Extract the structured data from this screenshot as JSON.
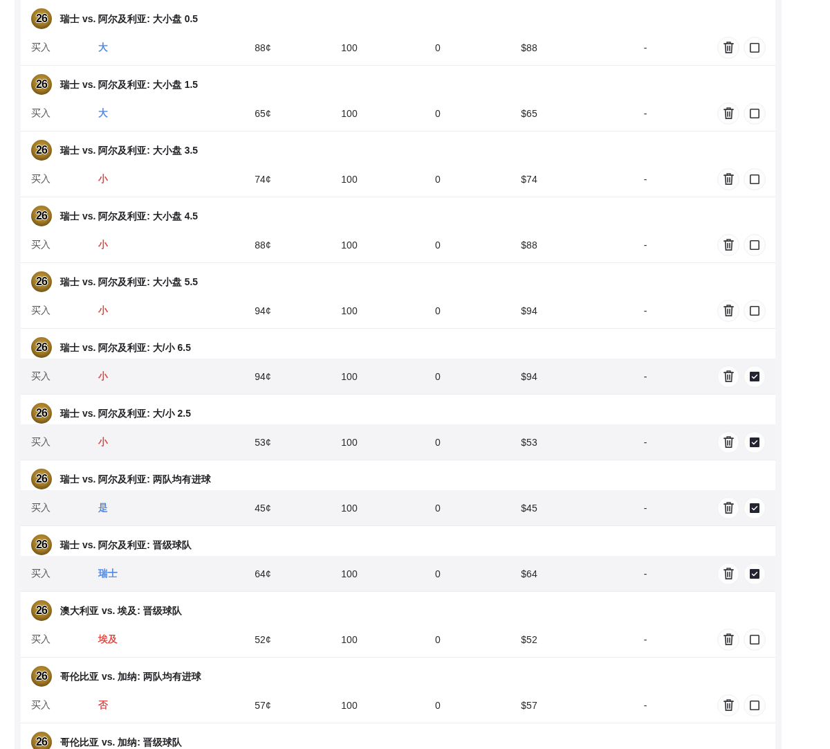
{
  "positions": [
    {
      "badge": "26",
      "title": "瑞士 vs. 阿尔及利亚: 大小盘 0.5",
      "column_1": "买入",
      "column_2": "大",
      "color": "#3f7de0",
      "column_3": "88¢",
      "column_4": "100",
      "column_5": "0",
      "column_6": "$88",
      "column_7": "-",
      "checked": false
    },
    {
      "badge": "26",
      "title": "瑞士 vs. 阿尔及利亚: 大小盘 1.5",
      "column_1": "买入",
      "column_2": "大",
      "color": "#3f7de0",
      "column_3": "65¢",
      "column_4": "100",
      "column_5": "0",
      "column_6": "$65",
      "column_7": "-",
      "checked": false
    },
    {
      "badge": "26",
      "title": "瑞士 vs. 阿尔及利亚: 大小盘 3.5",
      "column_1": "买入",
      "column_2": "小",
      "color": "#dc3b35",
      "column_3": "74¢",
      "column_4": "100",
      "column_5": "0",
      "column_6": "$74",
      "column_7": "-",
      "checked": false
    },
    {
      "badge": "26",
      "title": "瑞士 vs. 阿尔及利亚: 大小盘 4.5",
      "column_1": "买入",
      "column_2": "小",
      "color": "#dc3b35",
      "column_3": "88¢",
      "column_4": "100",
      "column_5": "0",
      "column_6": "$88",
      "column_7": "-",
      "checked": false
    },
    {
      "badge": "26",
      "title": "瑞士 vs. 阿尔及利亚: 大小盘 5.5",
      "column_1": "买入",
      "column_2": "小",
      "color": "#dc3b35",
      "column_3": "94¢",
      "column_4": "100",
      "column_5": "0",
      "column_6": "$94",
      "column_7": "-",
      "checked": false
    },
    {
      "badge": "26",
      "title": "瑞士 vs. 阿尔及利亚: 大/小 6.5",
      "column_1": "买入",
      "column_2": "小",
      "color": "#dc3b35",
      "column_3": "94¢",
      "column_4": "100",
      "column_5": "0",
      "column_6": "$94",
      "column_7": "-",
      "checked": true
    },
    {
      "badge": "26",
      "title": "瑞士 vs. 阿尔及利亚: 大/小 2.5",
      "column_1": "买入",
      "column_2": "小",
      "color": "#dc3b35",
      "column_3": "53¢",
      "column_4": "100",
      "column_5": "0",
      "column_6": "$53",
      "column_7": "-",
      "checked": true
    },
    {
      "badge": "26",
      "title": "瑞士 vs. 阿尔及利亚: 两队均有进球",
      "column_1": "买入",
      "column_2": "是",
      "color": "#3f7de0",
      "column_3": "45¢",
      "column_4": "100",
      "column_5": "0",
      "column_6": "$45",
      "column_7": "-",
      "checked": true
    },
    {
      "badge": "26",
      "title": "瑞士 vs. 阿尔及利亚: 晋级球队",
      "column_1": "买入",
      "column_2": "瑞士",
      "color": "#3f7de0",
      "column_3": "64¢",
      "column_4": "100",
      "column_5": "0",
      "column_6": "$64",
      "column_7": "-",
      "checked": true
    },
    {
      "badge": "26",
      "title": "澳大利亚 vs. 埃及: 晋级球队",
      "column_1": "买入",
      "column_2": "埃及",
      "color": "#dc3b35",
      "column_3": "52¢",
      "column_4": "100",
      "column_5": "0",
      "column_6": "$52",
      "column_7": "-",
      "checked": false
    },
    {
      "badge": "26",
      "title": "哥伦比亚 vs. 加纳: 两队均有进球",
      "column_1": "买入",
      "column_2": "否",
      "color": "#dc3b35",
      "column_3": "57¢",
      "column_4": "100",
      "column_5": "0",
      "column_6": "$57",
      "column_7": "-",
      "checked": false
    },
    {
      "badge": "26",
      "title": "哥伦比亚 vs. 加纳: 晋级球队"
    }
  ]
}
